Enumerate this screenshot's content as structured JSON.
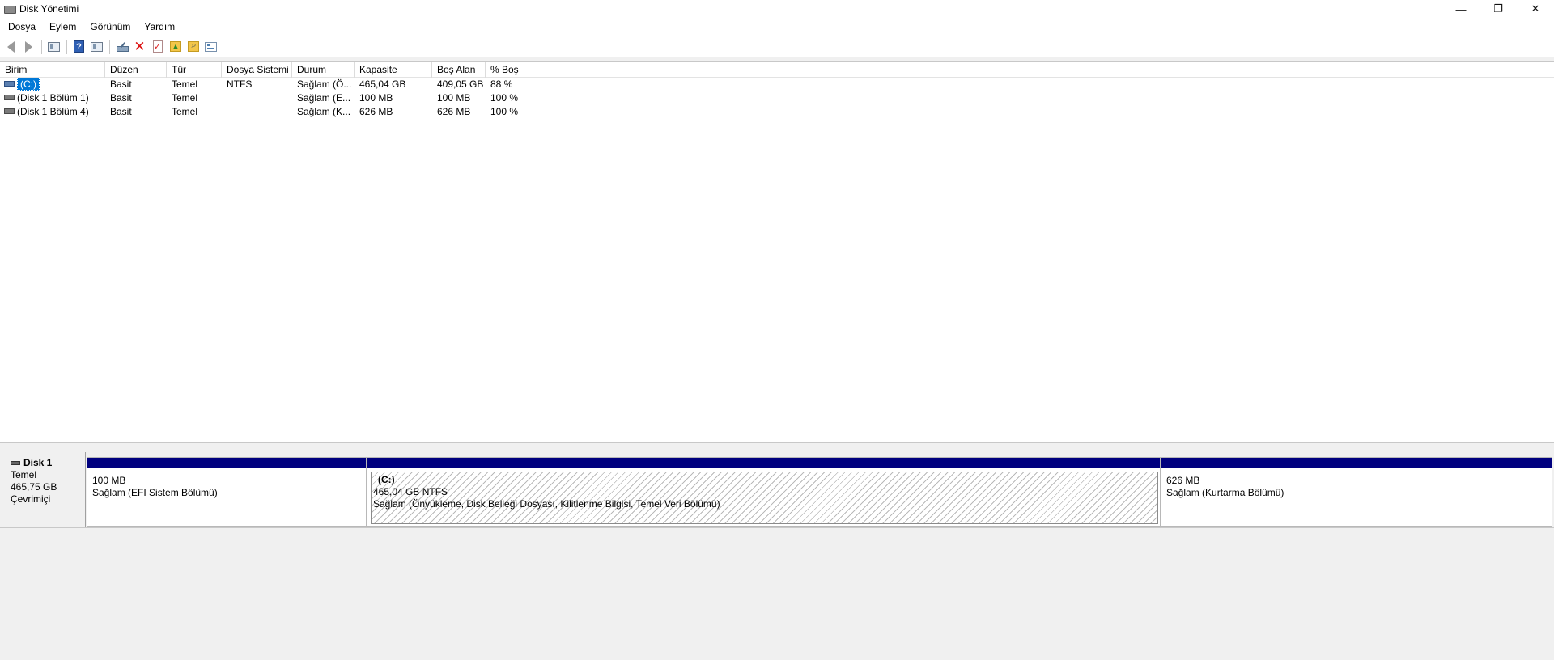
{
  "window": {
    "title": "Disk Yönetimi",
    "controls": {
      "minimize": "—",
      "restore": "❐",
      "close": "✕"
    }
  },
  "menu": [
    "Dosya",
    "Eylem",
    "Görünüm",
    "Yardım"
  ],
  "toolbar": {
    "buttons": [
      "back-icon",
      "forward-icon",
      "console-tree-icon",
      "help-icon",
      "show-hide-icon",
      "connect-disk-icon",
      "delete-icon",
      "check-icon",
      "folder-up-icon",
      "folder-find-icon",
      "properties-icon"
    ]
  },
  "volume_list": {
    "columns": [
      "Birim",
      "Düzen",
      "Tür",
      "Dosya Sistemi",
      "Durum",
      "Kapasite",
      "Boş Alan",
      "% Boş"
    ],
    "rows": [
      {
        "birim": "(C:)",
        "duzen": "Basit",
        "tur": "Temel",
        "dosya_sistemi": "NTFS",
        "durum": "Sağlam (Ö...",
        "kapasite": "465,04 GB",
        "bos_alan": "409,05 GB",
        "yuzde_bos": "88 %"
      },
      {
        "birim": "(Disk 1 Bölüm 1)",
        "duzen": "Basit",
        "tur": "Temel",
        "dosya_sistemi": "",
        "durum": "Sağlam (E...",
        "kapasite": "100 MB",
        "bos_alan": "100 MB",
        "yuzde_bos": "100 %"
      },
      {
        "birim": "(Disk 1 Bölüm 4)",
        "duzen": "Basit",
        "tur": "Temel",
        "dosya_sistemi": "",
        "durum": "Sağlam (K...",
        "kapasite": "626 MB",
        "bos_alan": "626 MB",
        "yuzde_bos": "100 %"
      }
    ]
  },
  "disk_map": {
    "disk": {
      "name": "Disk 1",
      "type": "Temel",
      "size": "465,75 GB",
      "status": "Çevrimiçi"
    },
    "partitions": [
      {
        "name": "",
        "size": "100 MB",
        "status": "Sağlam (EFI Sistem Bölümü)"
      },
      {
        "name": "(C:)",
        "size": "465,04 GB NTFS",
        "status": "Sağlam (Önyükleme, Disk Belleği Dosyası, Kilitlenme Bilgisi, Temel Veri Bölümü)"
      },
      {
        "name": "",
        "size": "626 MB",
        "status": "Sağlam (Kurtarma Bölümü)"
      }
    ],
    "bar_color": "#00007f"
  }
}
